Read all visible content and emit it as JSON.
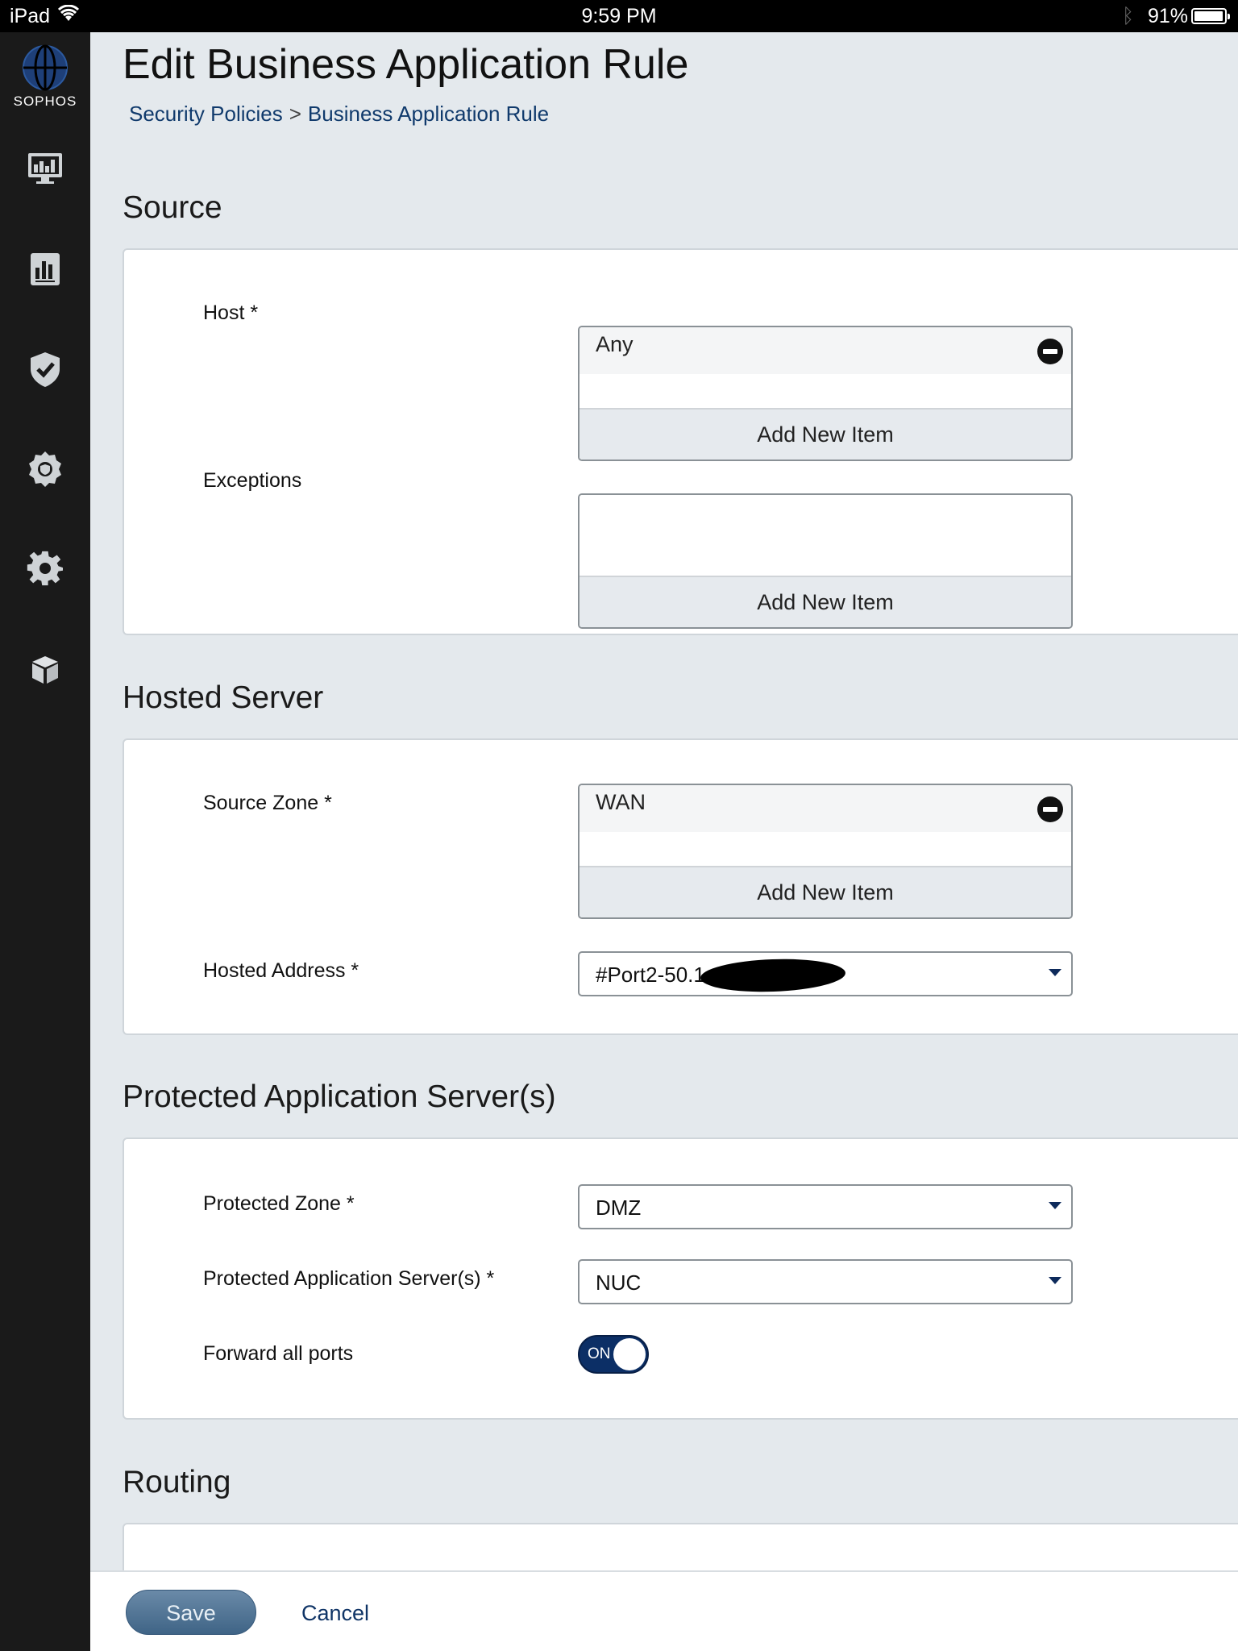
{
  "status_bar": {
    "device": "iPad",
    "time": "9:59 PM",
    "battery": "91%",
    "battery_level": 0.91
  },
  "sidebar": {
    "brand": "SOPHOS",
    "items": [
      {
        "icon": "monitor-dashboard-icon"
      },
      {
        "icon": "reports-icon"
      },
      {
        "icon": "shield-check-icon"
      },
      {
        "icon": "protection-gear-icon"
      },
      {
        "icon": "settings-gear-icon"
      },
      {
        "icon": "box-icon"
      }
    ]
  },
  "page": {
    "title": "Edit Business Application Rule",
    "breadcrumb": {
      "parent": "Security Policies",
      "separator": ">",
      "current": "Business Application Rule"
    }
  },
  "sections": {
    "source": {
      "title": "Source",
      "host_label": "Host *",
      "host_items": [
        "Any"
      ],
      "host_add": "Add New Item",
      "exceptions_label": "Exceptions",
      "exceptions_add": "Add New Item"
    },
    "hosted_server": {
      "title": "Hosted Server",
      "source_zone_label": "Source Zone *",
      "source_zone_items": [
        "WAN"
      ],
      "source_zone_add": "Add New Item",
      "hosted_address_label": "Hosted Address *",
      "hosted_address_value": "#Port2-50.1"
    },
    "protected": {
      "title": "Protected Application Server(s)",
      "zone_label": "Protected Zone *",
      "zone_value": "DMZ",
      "servers_label": "Protected Application Server(s) *",
      "servers_value": "NUC",
      "forward_label": "Forward all ports",
      "forward_state": "ON"
    },
    "routing": {
      "title": "Routing"
    }
  },
  "footer": {
    "save": "Save",
    "cancel": "Cancel"
  },
  "colors": {
    "sidebar_bg": "#1a1a1a",
    "page_bg": "#e4e9ed",
    "link": "#103a6c",
    "toggle_on": "#0c2f66",
    "save_button": "#4f7294"
  }
}
